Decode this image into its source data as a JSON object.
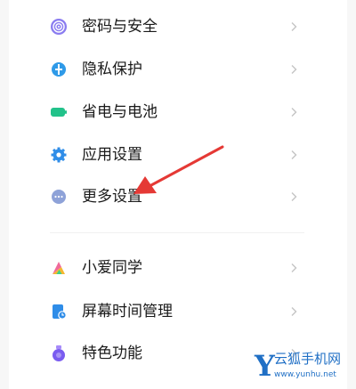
{
  "group1": [
    {
      "label": "密码与安全",
      "icon": "fingerprint-icon",
      "color": "#8a7cf0"
    },
    {
      "label": "隐私保护",
      "icon": "privacy-icon",
      "color": "#2f9ae8"
    },
    {
      "label": "省电与电池",
      "icon": "battery-icon",
      "color": "#22c28a"
    },
    {
      "label": "应用设置",
      "icon": "gear-icon",
      "color": "#2f8de8"
    },
    {
      "label": "更多设置",
      "icon": "more-icon",
      "color": "#8ea2d8"
    }
  ],
  "group2": [
    {
      "label": "小爱同学",
      "icon": "xiaoai-icon",
      "color": "#f08a24"
    },
    {
      "label": "屏幕时间管理",
      "icon": "screen-time-icon",
      "color": "#2f8de8"
    },
    {
      "label": "特色功能",
      "icon": "feature-icon",
      "color": "#7a5cf0"
    }
  ],
  "annotation": {
    "color": "#e53935"
  },
  "watermark": {
    "letter": "Y",
    "name": "云狐手机网",
    "url": "www.yunhu.net"
  }
}
